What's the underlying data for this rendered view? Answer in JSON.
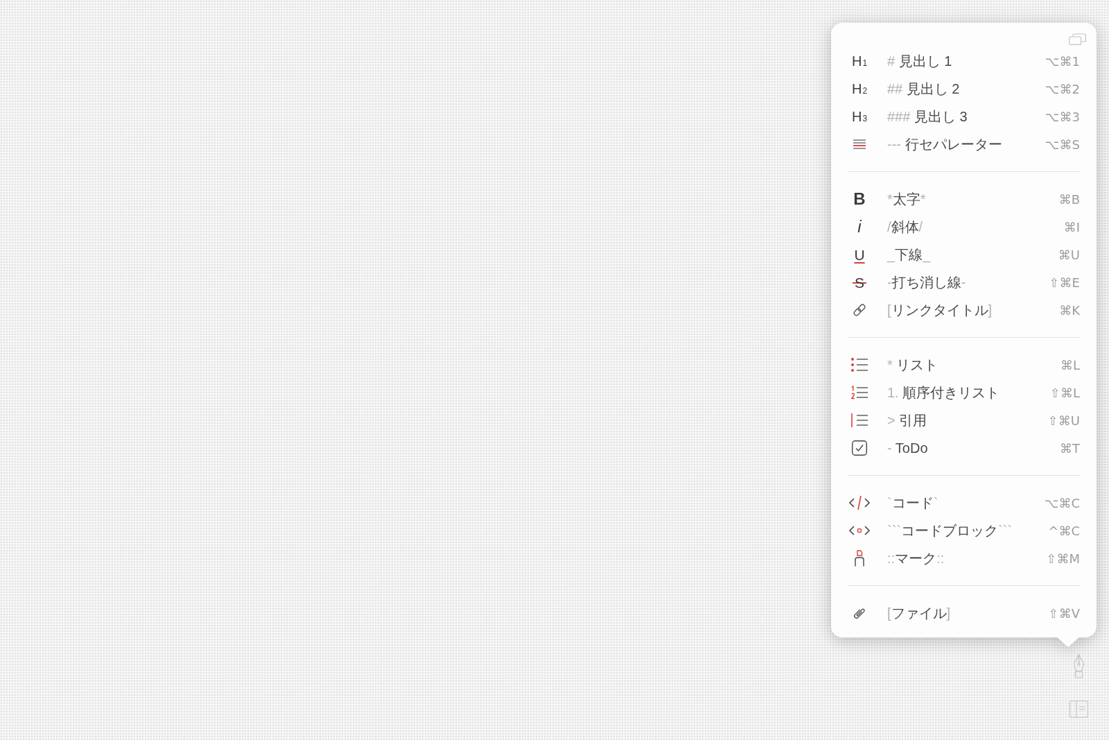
{
  "popover": {
    "sections": [
      {
        "items": [
          {
            "kind": "heading",
            "icon_text": "H$_{1}$",
            "prefix": "# ",
            "label": "見出し 1",
            "shortcut": "⌥⌘1"
          },
          {
            "kind": "heading",
            "icon_text": "H$_{2}$",
            "prefix": "## ",
            "label": "見出し 2",
            "shortcut": "⌥⌘2"
          },
          {
            "kind": "heading",
            "icon_text": "H$_{3}$",
            "prefix": "### ",
            "label": "見出し 3",
            "shortcut": "⌥⌘3"
          },
          {
            "kind": "separator",
            "prefix": "--- ",
            "label": "行セパレーター",
            "shortcut": "⌥⌘S"
          }
        ]
      },
      {
        "items": [
          {
            "kind": "bold",
            "icon_text": "B",
            "prefix": "*",
            "label": "太字",
            "suffix": "*",
            "shortcut": "⌘B"
          },
          {
            "kind": "italic",
            "icon_text": "i",
            "prefix": "/",
            "label": "斜体",
            "suffix": "/",
            "shortcut": "⌘I"
          },
          {
            "kind": "underline",
            "icon_text": "U",
            "prefix": "_",
            "label": "下線",
            "suffix": "_",
            "shortcut": "⌘U"
          },
          {
            "kind": "strikethrough",
            "icon_text": "S",
            "prefix": "-",
            "label": "打ち消し線",
            "suffix": "-",
            "shortcut": "⇧⌘E"
          },
          {
            "kind": "link",
            "prefix": "[",
            "label": "リンクタイトル",
            "suffix": "]",
            "shortcut": "⌘K"
          }
        ]
      },
      {
        "items": [
          {
            "kind": "bullet-list",
            "prefix": "* ",
            "label": "リスト",
            "shortcut": "⌘L"
          },
          {
            "kind": "numbered-list",
            "prefix": "1. ",
            "label": "順序付きリスト",
            "shortcut": "⇧⌘L"
          },
          {
            "kind": "quote",
            "prefix": "> ",
            "label": "引用",
            "shortcut": "⇧⌘U"
          },
          {
            "kind": "todo",
            "prefix": "- ",
            "label": "ToDo",
            "shortcut": "⌘T"
          }
        ]
      },
      {
        "items": [
          {
            "kind": "code",
            "prefix": "`",
            "label": "コード",
            "suffix": "`",
            "shortcut": "⌥⌘C"
          },
          {
            "kind": "code-block",
            "prefix": "```",
            "label": "コードブロック",
            "suffix": "```",
            "shortcut": "^⌘C"
          },
          {
            "kind": "mark",
            "prefix": "::",
            "label": "マーク",
            "suffix": "::",
            "shortcut": "⇧⌘M"
          }
        ]
      },
      {
        "items": [
          {
            "kind": "file",
            "prefix": "[",
            "label": "ファイル",
            "suffix": "]",
            "shortcut": "⇧⌘V"
          }
        ]
      }
    ]
  }
}
